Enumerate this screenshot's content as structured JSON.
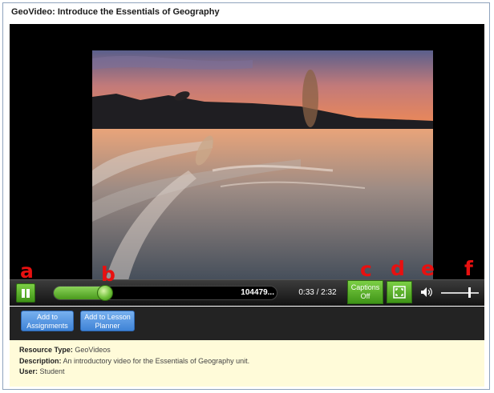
{
  "window": {
    "title": "GeoVideo: Introduce the Essentials of Geography"
  },
  "player": {
    "progress_fraction": 0.23,
    "track_label": "104479...",
    "time": "0:33 / 2:32",
    "captions": {
      "line1": "Captions",
      "line2": "Off"
    },
    "volume_fraction": 0.75,
    "icons": {
      "pause": "pause-icon",
      "fullscreen": "fullscreen-icon",
      "volume": "volume-icon"
    }
  },
  "markers": [
    "a",
    "b",
    "c",
    "d",
    "e",
    "f"
  ],
  "actions": [
    {
      "line1": "Add to",
      "line2": "Assignments"
    },
    {
      "line1": "Add to Lesson",
      "line2": "Planner"
    }
  ],
  "info": {
    "resource_type": {
      "label": "Resource Type:",
      "value": "GeoVideos"
    },
    "description": {
      "label": "Description:",
      "value": "An introductory video for the Essentials of Geography unit."
    },
    "user": {
      "label": "User:",
      "value": "Student"
    }
  },
  "colors": {
    "accent_green": "#4a9a1c",
    "button_blue": "#3f83d6",
    "marker_red": "#e81010",
    "info_bg": "#fffbd9"
  }
}
